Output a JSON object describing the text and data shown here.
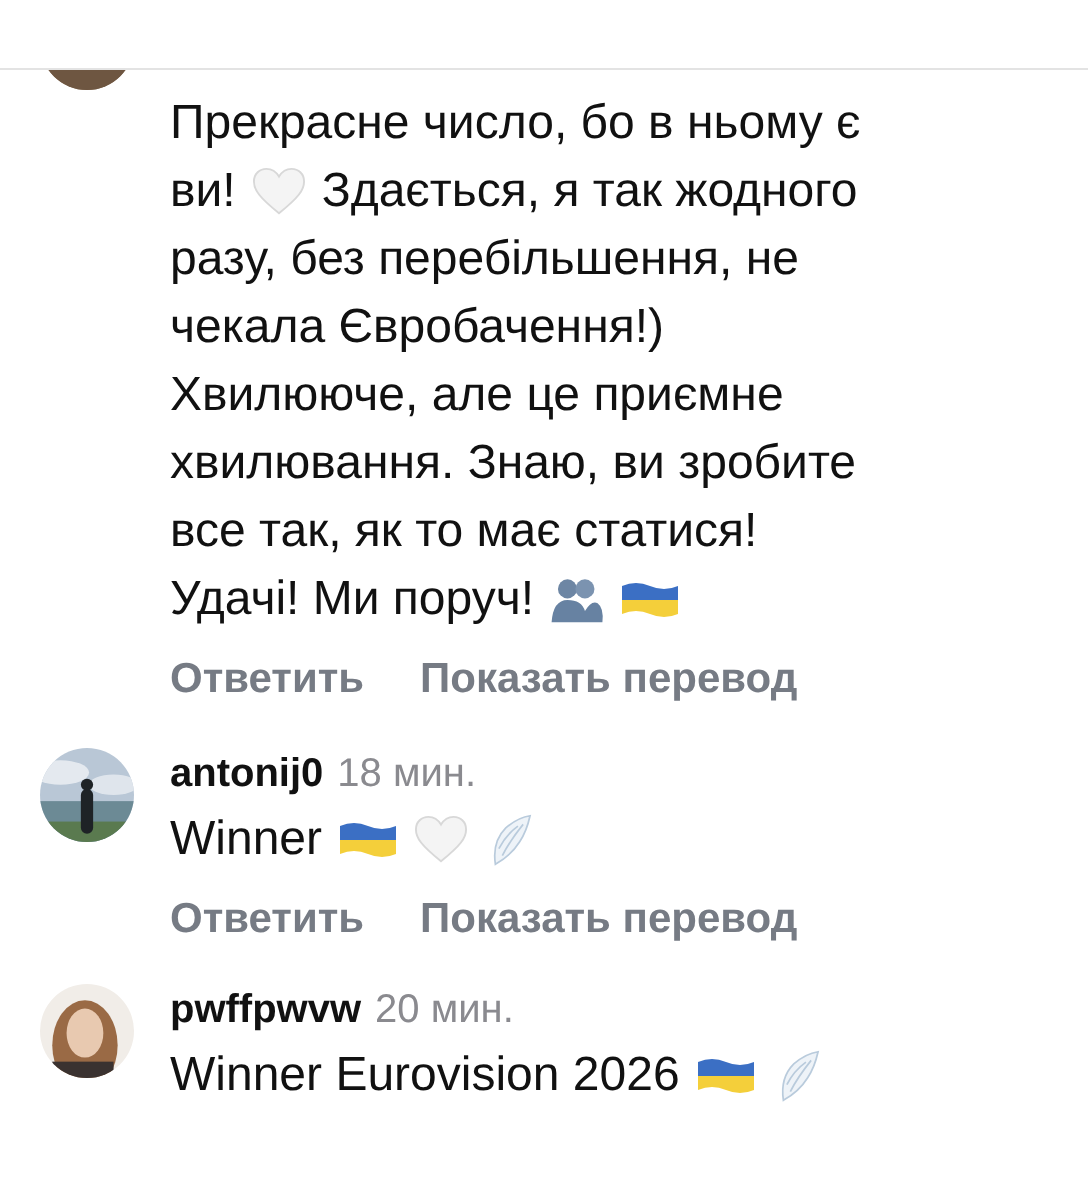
{
  "comments": [
    {
      "avatar": {
        "kind": "picture"
      },
      "lines": [
        [
          {
            "kind": "text",
            "text": "Прекрасне число, бо в ньому є"
          }
        ],
        [
          {
            "kind": "text",
            "text": "ви!"
          },
          {
            "kind": "heart"
          },
          {
            "kind": "text",
            "text": "Здається, я так жодного"
          }
        ],
        [
          {
            "kind": "text",
            "text": "разу, без перебільшення, не"
          }
        ],
        [
          {
            "kind": "text",
            "text": "чекала Євробачення!)"
          }
        ],
        [
          {
            "kind": "text",
            "text": "Хвилююче, але це приємне"
          }
        ],
        [
          {
            "kind": "text",
            "text": "хвилювання. Знаю, ви зробите"
          }
        ],
        [
          {
            "kind": "text",
            "text": "все так, як то має статися!"
          }
        ],
        [
          {
            "kind": "text",
            "text": "Удачі! Ми поруч!"
          },
          {
            "kind": "hug"
          },
          {
            "kind": "flag"
          }
        ]
      ],
      "actions": [
        "Ответить",
        "Показать перевод"
      ]
    },
    {
      "avatar": {
        "kind": "picture"
      },
      "username": "antonij0",
      "time": "18 мин.",
      "lines": [
        [
          {
            "kind": "text",
            "text": "Winner"
          },
          {
            "kind": "flag"
          },
          {
            "kind": "heart"
          },
          {
            "kind": "wings"
          }
        ]
      ],
      "actions": [
        "Ответить",
        "Показать перевод"
      ]
    },
    {
      "avatar": {
        "kind": "picture"
      },
      "username": "pwffpwvw",
      "time": "20 мин.",
      "lines": [
        [
          {
            "kind": "text",
            "text": "Winner Eurovision 2026"
          },
          {
            "kind": "flag"
          },
          {
            "kind": "wings"
          }
        ]
      ]
    }
  ]
}
